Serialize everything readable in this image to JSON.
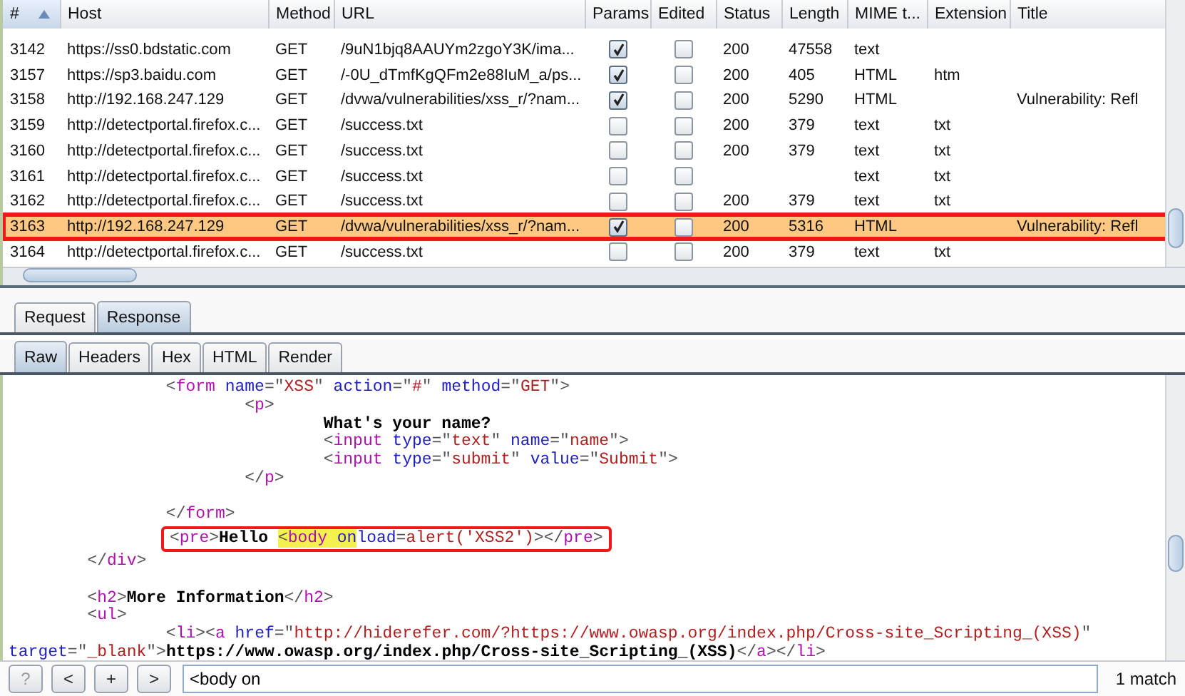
{
  "table": {
    "columns": [
      {
        "label": "#",
        "sorted": true
      },
      {
        "label": "Host",
        "sorted": false
      },
      {
        "label": "Method",
        "sorted": false
      },
      {
        "label": "URL",
        "sorted": false
      },
      {
        "label": "Params",
        "sorted": false
      },
      {
        "label": "Edited",
        "sorted": false
      },
      {
        "label": "Status",
        "sorted": false
      },
      {
        "label": "Length",
        "sorted": false
      },
      {
        "label": "MIME t...",
        "sorted": false
      },
      {
        "label": "Extension",
        "sorted": false
      },
      {
        "label": "Title",
        "sorted": false
      }
    ],
    "rows": [
      {
        "id": "3142",
        "host": "https://ss0.bdstatic.com",
        "method": "GET",
        "url": "/9uN1bjq8AAUYm2zgoY3K/ima...",
        "params": true,
        "edited": false,
        "status": "200",
        "length": "47558",
        "mime": "text",
        "extension": "",
        "title": "",
        "selected": false,
        "annotated": false
      },
      {
        "id": "3157",
        "host": "https://sp3.baidu.com",
        "method": "GET",
        "url": "/-0U_dTmfKgQFm2e88IuM_a/ps...",
        "params": true,
        "edited": false,
        "status": "200",
        "length": "405",
        "mime": "HTML",
        "extension": "htm",
        "title": "",
        "selected": false,
        "annotated": false
      },
      {
        "id": "3158",
        "host": "http://192.168.247.129",
        "method": "GET",
        "url": "/dvwa/vulnerabilities/xss_r/?nam...",
        "params": true,
        "edited": false,
        "status": "200",
        "length": "5290",
        "mime": "HTML",
        "extension": "",
        "title": "Vulnerability: Refl",
        "selected": false,
        "annotated": false
      },
      {
        "id": "3159",
        "host": "http://detectportal.firefox.c...",
        "method": "GET",
        "url": "/success.txt",
        "params": false,
        "edited": false,
        "status": "200",
        "length": "379",
        "mime": "text",
        "extension": "txt",
        "title": "",
        "selected": false,
        "annotated": false
      },
      {
        "id": "3160",
        "host": "http://detectportal.firefox.c...",
        "method": "GET",
        "url": "/success.txt",
        "params": false,
        "edited": false,
        "status": "200",
        "length": "379",
        "mime": "text",
        "extension": "txt",
        "title": "",
        "selected": false,
        "annotated": false
      },
      {
        "id": "3161",
        "host": "http://detectportal.firefox.c...",
        "method": "GET",
        "url": "/success.txt",
        "params": false,
        "edited": false,
        "status": "",
        "length": "",
        "mime": "text",
        "extension": "txt",
        "title": "",
        "selected": false,
        "annotated": false
      },
      {
        "id": "3162",
        "host": "http://detectportal.firefox.c...",
        "method": "GET",
        "url": "/success.txt",
        "params": false,
        "edited": false,
        "status": "200",
        "length": "379",
        "mime": "text",
        "extension": "txt",
        "title": "",
        "selected": false,
        "annotated": false
      },
      {
        "id": "3163",
        "host": "http://192.168.247.129",
        "method": "GET",
        "url": "/dvwa/vulnerabilities/xss_r/?nam...",
        "params": true,
        "edited": false,
        "status": "200",
        "length": "5316",
        "mime": "HTML",
        "extension": "",
        "title": "Vulnerability: Refl",
        "selected": true,
        "annotated": true
      },
      {
        "id": "3164",
        "host": "http://detectportal.firefox.c...",
        "method": "GET",
        "url": "/success.txt",
        "params": false,
        "edited": false,
        "status": "200",
        "length": "379",
        "mime": "text",
        "extension": "txt",
        "title": "",
        "selected": false,
        "annotated": false
      }
    ]
  },
  "tabs": [
    {
      "label": "Request",
      "selected": false
    },
    {
      "label": "Response",
      "selected": true
    }
  ],
  "subtabs": [
    {
      "label": "Raw",
      "selected": true
    },
    {
      "label": "Headers",
      "selected": false
    },
    {
      "label": "Hex",
      "selected": false
    },
    {
      "label": "HTML",
      "selected": false
    },
    {
      "label": "Render",
      "selected": false
    }
  ],
  "code_lines": [
    {
      "kind": "code",
      "annotated": false,
      "segments": [
        {
          "kind": "punct",
          "text": "                <"
        },
        {
          "kind": "tag",
          "text": "form"
        },
        {
          "kind": "attr",
          "text": " name"
        },
        {
          "kind": "punct",
          "text": "=\""
        },
        {
          "kind": "value",
          "text": "XSS"
        },
        {
          "kind": "punct",
          "text": "\""
        },
        {
          "kind": "attr",
          "text": " action"
        },
        {
          "kind": "punct",
          "text": "=\""
        },
        {
          "kind": "value",
          "text": "#"
        },
        {
          "kind": "punct",
          "text": "\""
        },
        {
          "kind": "attr",
          "text": " method"
        },
        {
          "kind": "punct",
          "text": "=\""
        },
        {
          "kind": "value",
          "text": "GET"
        },
        {
          "kind": "punct",
          "text": "\">"
        }
      ]
    },
    {
      "kind": "code",
      "annotated": false,
      "segments": [
        {
          "kind": "punct",
          "text": "                        <"
        },
        {
          "kind": "tag",
          "text": "p"
        },
        {
          "kind": "punct",
          "text": ">"
        }
      ]
    },
    {
      "kind": "code",
      "annotated": false,
      "segments": [
        {
          "kind": "text",
          "text": "                                What's your name?"
        }
      ]
    },
    {
      "kind": "code",
      "annotated": false,
      "segments": [
        {
          "kind": "punct",
          "text": "                                <"
        },
        {
          "kind": "tag",
          "text": "input"
        },
        {
          "kind": "attr",
          "text": " type"
        },
        {
          "kind": "punct",
          "text": "=\""
        },
        {
          "kind": "value",
          "text": "text"
        },
        {
          "kind": "punct",
          "text": "\""
        },
        {
          "kind": "attr",
          "text": " name"
        },
        {
          "kind": "punct",
          "text": "=\""
        },
        {
          "kind": "value",
          "text": "name"
        },
        {
          "kind": "punct",
          "text": "\">"
        }
      ]
    },
    {
      "kind": "code",
      "annotated": false,
      "segments": [
        {
          "kind": "punct",
          "text": "                                <"
        },
        {
          "kind": "tag",
          "text": "input"
        },
        {
          "kind": "attr",
          "text": " type"
        },
        {
          "kind": "punct",
          "text": "=\""
        },
        {
          "kind": "value",
          "text": "submit"
        },
        {
          "kind": "punct",
          "text": "\""
        },
        {
          "kind": "attr",
          "text": " value"
        },
        {
          "kind": "punct",
          "text": "=\""
        },
        {
          "kind": "value",
          "text": "Submit"
        },
        {
          "kind": "punct",
          "text": "\">"
        }
      ]
    },
    {
      "kind": "code",
      "annotated": false,
      "segments": [
        {
          "kind": "punct",
          "text": "                        </"
        },
        {
          "kind": "tag",
          "text": "p"
        },
        {
          "kind": "punct",
          "text": ">"
        }
      ]
    },
    {
      "kind": "blank"
    },
    {
      "kind": "code",
      "annotated": false,
      "segments": [
        {
          "kind": "punct",
          "text": "                </"
        },
        {
          "kind": "tag",
          "text": "form"
        },
        {
          "kind": "punct",
          "text": ">"
        }
      ]
    },
    {
      "kind": "code",
      "annotated": true,
      "segments": [
        {
          "kind": "punct",
          "text": "<"
        },
        {
          "kind": "tag",
          "text": "pre"
        },
        {
          "kind": "punct",
          "text": ">"
        },
        {
          "kind": "text",
          "text": "Hello "
        },
        {
          "kind": "punct",
          "text": "<",
          "highlight": true
        },
        {
          "kind": "tag",
          "text": "body",
          "highlight": true
        },
        {
          "kind": "attr",
          "text": " on",
          "highlight": true
        },
        {
          "kind": "attr",
          "text": "load"
        },
        {
          "kind": "punct",
          "text": "="
        },
        {
          "kind": "value",
          "text": "alert('XSS2')"
        },
        {
          "kind": "punct",
          "text": "></"
        },
        {
          "kind": "tag",
          "text": "pre"
        },
        {
          "kind": "punct",
          "text": ">"
        }
      ]
    },
    {
      "kind": "code",
      "annotated": false,
      "segments": [
        {
          "kind": "punct",
          "text": "        </"
        },
        {
          "kind": "tag",
          "text": "div"
        },
        {
          "kind": "punct",
          "text": ">"
        }
      ]
    },
    {
      "kind": "blank"
    },
    {
      "kind": "code",
      "annotated": false,
      "segments": [
        {
          "kind": "punct",
          "text": "        <"
        },
        {
          "kind": "tag",
          "text": "h2"
        },
        {
          "kind": "punct",
          "text": ">"
        },
        {
          "kind": "text",
          "text": "More Information"
        },
        {
          "kind": "punct",
          "text": "</"
        },
        {
          "kind": "tag",
          "text": "h2"
        },
        {
          "kind": "punct",
          "text": ">"
        }
      ]
    },
    {
      "kind": "code",
      "annotated": false,
      "segments": [
        {
          "kind": "punct",
          "text": "        <"
        },
        {
          "kind": "tag",
          "text": "ul"
        },
        {
          "kind": "punct",
          "text": ">"
        }
      ]
    },
    {
      "kind": "code",
      "annotated": false,
      "segments": [
        {
          "kind": "punct",
          "text": "                <"
        },
        {
          "kind": "tag",
          "text": "li"
        },
        {
          "kind": "punct",
          "text": "><"
        },
        {
          "kind": "tag",
          "text": "a"
        },
        {
          "kind": "attr",
          "text": " href"
        },
        {
          "kind": "punct",
          "text": "=\""
        },
        {
          "kind": "value",
          "text": "http://hiderefer.com/?https://www.owasp.org/index.php/Cross-site_Scripting_(XSS)"
        },
        {
          "kind": "punct",
          "text": "\""
        }
      ]
    },
    {
      "kind": "code",
      "annotated": false,
      "segments": [
        {
          "kind": "attr",
          "text": "target"
        },
        {
          "kind": "punct",
          "text": "=\""
        },
        {
          "kind": "value",
          "text": "_blank"
        },
        {
          "kind": "punct",
          "text": "\">"
        },
        {
          "kind": "text",
          "text": "https://www.owasp.org/index.php/Cross-site_Scripting_(XSS)"
        },
        {
          "kind": "punct",
          "text": "</"
        },
        {
          "kind": "tag",
          "text": "a"
        },
        {
          "kind": "punct",
          "text": "></"
        },
        {
          "kind": "tag",
          "text": "li"
        },
        {
          "kind": "punct",
          "text": ">"
        }
      ]
    }
  ],
  "search_bar": {
    "buttons": [
      {
        "label": "?",
        "disabled": true
      },
      {
        "label": "<",
        "disabled": false
      },
      {
        "label": "+",
        "disabled": false
      },
      {
        "label": ">",
        "disabled": false
      }
    ],
    "value": "<body on",
    "result": "1 match"
  }
}
